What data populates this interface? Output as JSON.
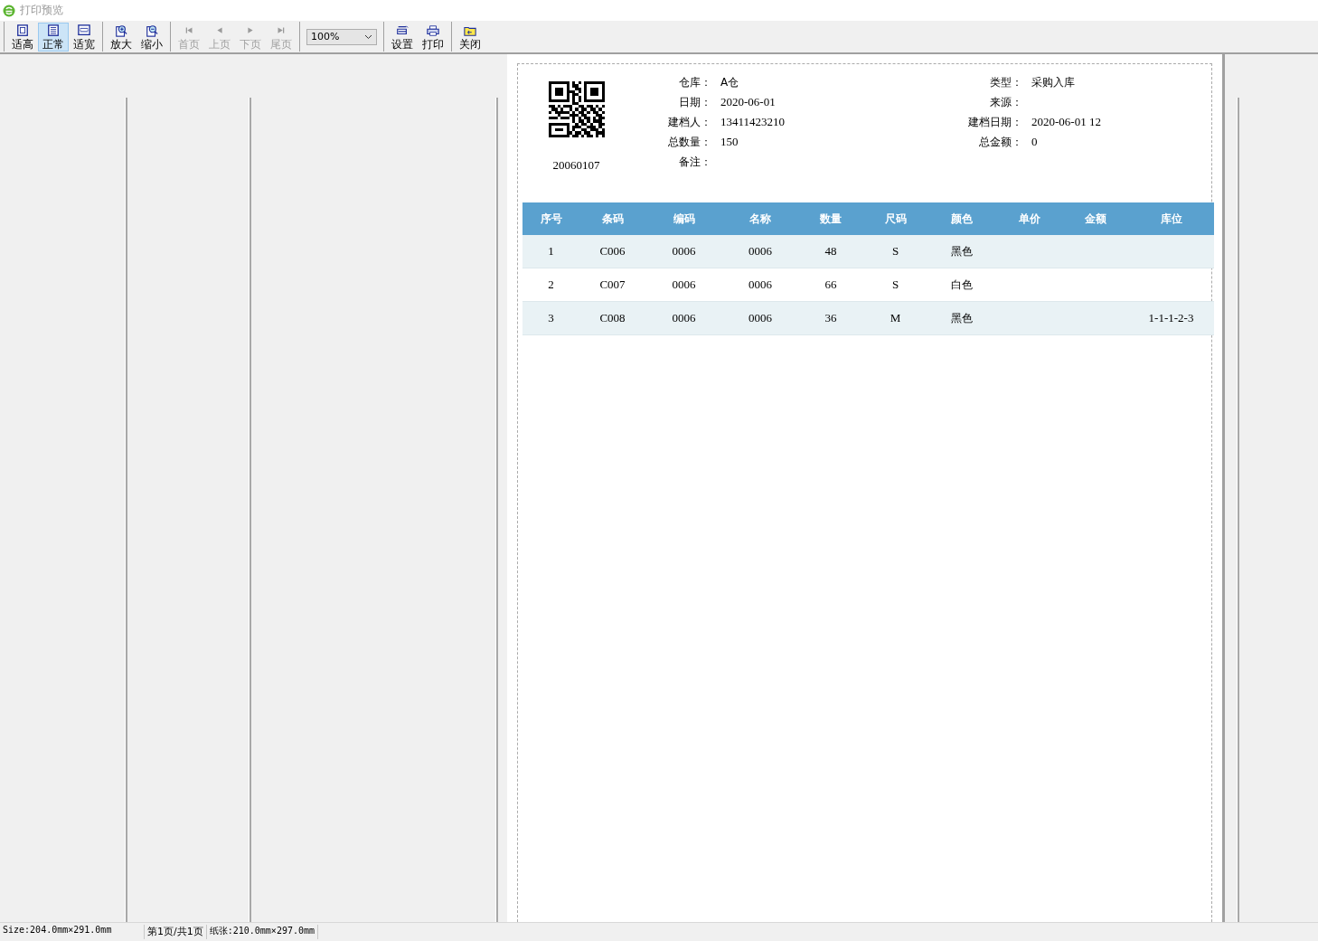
{
  "window": {
    "title": "打印预览"
  },
  "toolbar": {
    "groups": [
      [
        {
          "kind": "button",
          "label": "适高",
          "selected": false,
          "disabled": false
        },
        {
          "kind": "button",
          "label": "正常",
          "selected": true,
          "disabled": false
        },
        {
          "kind": "button",
          "label": "适宽",
          "selected": false,
          "disabled": false
        }
      ],
      [
        {
          "kind": "button",
          "label": "放大",
          "selected": false,
          "disabled": false
        },
        {
          "kind": "button",
          "label": "缩小",
          "selected": false,
          "disabled": false
        }
      ],
      [
        {
          "kind": "button",
          "label": "首页",
          "selected": false,
          "disabled": true
        },
        {
          "kind": "button",
          "label": "上页",
          "selected": false,
          "disabled": true
        },
        {
          "kind": "button",
          "label": "下页",
          "selected": false,
          "disabled": true
        },
        {
          "kind": "button",
          "label": "尾页",
          "selected": false,
          "disabled": true
        }
      ],
      [
        {
          "kind": "select",
          "value": "100%"
        }
      ],
      [
        {
          "kind": "button",
          "label": "设置",
          "selected": false,
          "disabled": false
        },
        {
          "kind": "button",
          "label": "打印",
          "selected": false,
          "disabled": false
        }
      ],
      [
        {
          "kind": "button",
          "label": "关闭",
          "selected": false,
          "disabled": false
        }
      ]
    ]
  },
  "document": {
    "barcode_number": "20060107",
    "fields_left": [
      {
        "label": "仓库：",
        "value": "A仓"
      },
      {
        "label": "日期：",
        "value": "2020-06-01"
      },
      {
        "label": "建档人：",
        "value": "13411423210"
      },
      {
        "label": "总数量：",
        "value": "150"
      },
      {
        "label": "备注："
      }
    ],
    "fields_right": [
      {
        "label": "类型：",
        "value": "采购入库"
      },
      {
        "label": "来源："
      },
      {
        "label": "建档日期：",
        "value": "2020-06-01 12"
      },
      {
        "label": "总金额：",
        "value": "0"
      }
    ],
    "table": {
      "columns": [
        "序号",
        "条码",
        "编码",
        "名称",
        "数量",
        "尺码",
        "颜色",
        "单价",
        "金额",
        "库位"
      ],
      "rows": [
        [
          "1",
          "C006",
          "0006",
          "0006",
          "48",
          "S",
          "黑色",
          "",
          "",
          ""
        ],
        [
          "2",
          "C007",
          "0006",
          "0006",
          "66",
          "S",
          "白色",
          "",
          "",
          ""
        ],
        [
          "3",
          "C008",
          "0006",
          "0006",
          "36",
          "M",
          "黑色",
          "",
          "",
          "1-1-1-2-3"
        ]
      ]
    }
  },
  "status_bar": [
    "Size:204.0mm×291.0mm",
    "第1页/共1页",
    "纸张:210.0mm×297.0mm"
  ]
}
